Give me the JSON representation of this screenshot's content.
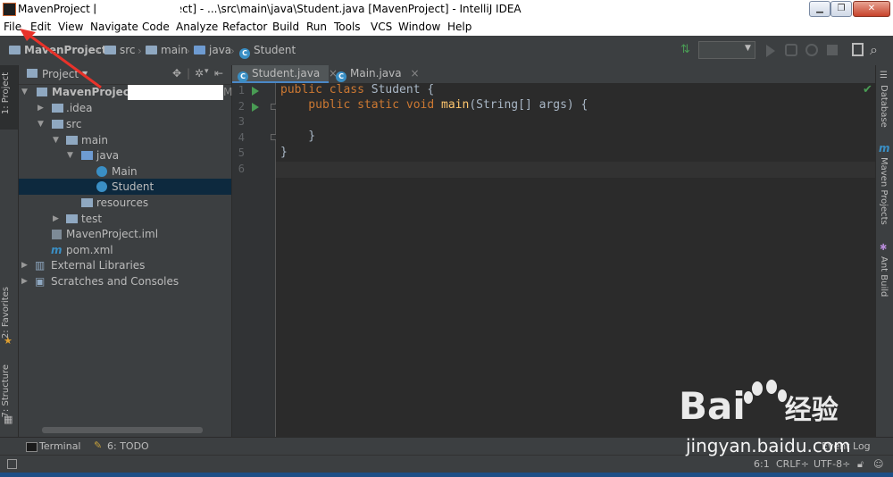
{
  "window": {
    "title": "MavenProject [D:\\                    \\MavenProject] - ...\\src\\main\\java\\Student.java [MavenProject] - IntelliJ IDEA",
    "min_label": "▁",
    "max_label": "❐",
    "close_label": "✕"
  },
  "menu": [
    "File",
    "Edit",
    "View",
    "Navigate",
    "Code",
    "Analyze",
    "Refactor",
    "Build",
    "Run",
    "Tools",
    "VCS",
    "Window",
    "Help"
  ],
  "breadcrumbs": [
    "MavenProject",
    "src",
    "main",
    "java",
    "Student"
  ],
  "project_panel": {
    "header": "Project",
    "tree": [
      {
        "label": "MavenProject",
        "bold": true
      },
      {
        "label": ".idea"
      },
      {
        "label": "src"
      },
      {
        "label": "main"
      },
      {
        "label": "java"
      },
      {
        "label": "Main"
      },
      {
        "label": "Student",
        "selected": true
      },
      {
        "label": "resources"
      },
      {
        "label": "test"
      },
      {
        "label": "MavenProject.iml"
      },
      {
        "label": "pom.xml"
      },
      {
        "label": "External Libraries"
      },
      {
        "label": "Scratches and Consoles"
      }
    ]
  },
  "left_tool_tabs": [
    "1: Project",
    "2: Favorites",
    "7: Structure"
  ],
  "right_tool_tabs": [
    "Database",
    "Maven Projects",
    "Ant Build"
  ],
  "editor": {
    "tabs": [
      {
        "label": "Student.java",
        "active": true
      },
      {
        "label": "Main.java",
        "active": false
      }
    ],
    "line_numbers": [
      "1",
      "2",
      "3",
      "4",
      "5",
      "6"
    ],
    "lines": [
      {
        "kw": "public class ",
        "name": "Student",
        "rest": " {"
      },
      {
        "kw": "    public static void ",
        "fn": "main",
        "rest": "(String[] args) {"
      },
      {
        "plain": ""
      },
      {
        "plain": "    }"
      },
      {
        "plain": "}"
      },
      {
        "plain": ""
      }
    ]
  },
  "bottom_tools": {
    "terminal": "Terminal",
    "todo": "6: TODO",
    "event_log": "Event Log"
  },
  "status": {
    "position": "6:1",
    "line_sep": "CRLF÷",
    "encoding": "UTF-8÷"
  },
  "watermark": {
    "logo": "Bai",
    "logo_tail": "经验",
    "url": "jingyan.baidu.com"
  },
  "colors": {
    "background": "#2b2b2b",
    "panel": "#3c3f41",
    "keyword": "#cc7832",
    "method": "#ffc66d",
    "selection": "#0d293e",
    "run_green": "#499c54"
  }
}
